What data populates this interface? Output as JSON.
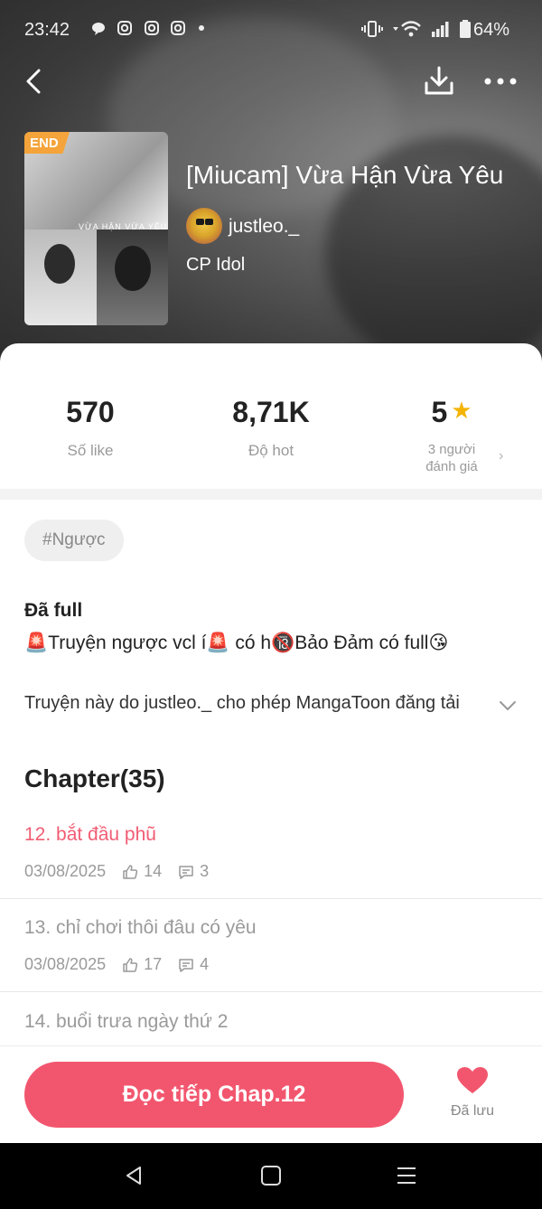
{
  "status_bar": {
    "time": "23:42",
    "battery": "64%",
    "left_icons": [
      "message-icon",
      "instagram-icon",
      "instagram-icon",
      "instagram-icon",
      "dot-icon"
    ],
    "right_icons": [
      "vibrate-icon",
      "wifi-icon",
      "signal-icon",
      "battery-icon"
    ]
  },
  "story": {
    "title": "[Miucam] Vừa Hận Vừa Yêu",
    "author": "justleo._",
    "genre": "CP Idol",
    "end_badge": "END",
    "cover_caption": "VỪA HẬN VỪA YÊU"
  },
  "stats": {
    "likes_value": "570",
    "likes_label": "Số like",
    "hot_value": "8,71K",
    "hot_label": "Độ hot",
    "rating_value": "5",
    "rating_line1": "3 người",
    "rating_line2": "đánh giá"
  },
  "tags": [
    "#Ngược"
  ],
  "description": {
    "status": "Đã full",
    "text": "🚨Truyện ngược vcl í🚨 có h🔞Bảo Đảm có full😘",
    "permission": "Truyện này do justleo._ cho phép MangaToon đăng tải"
  },
  "chapters": {
    "heading": "Chapter(35)",
    "items": [
      {
        "title": "12. bắt đầu phũ",
        "date": "03/08/2025",
        "likes": "14",
        "comments": "3",
        "current": true
      },
      {
        "title": "13. chỉ chơi thôi đâu có yêu",
        "date": "03/08/2025",
        "likes": "17",
        "comments": "4",
        "current": false
      },
      {
        "title": "14. buổi trưa ngày thứ 2",
        "date": "",
        "likes": "",
        "comments": "",
        "current": false
      }
    ]
  },
  "actions": {
    "continue_label": "Đọc tiếp Chap.12",
    "saved_label": "Đã lưu"
  },
  "colors": {
    "accent": "#f2566e",
    "current_chapter": "#f15d74",
    "star": "#f5b400",
    "end_badge": "#f4a43a"
  }
}
